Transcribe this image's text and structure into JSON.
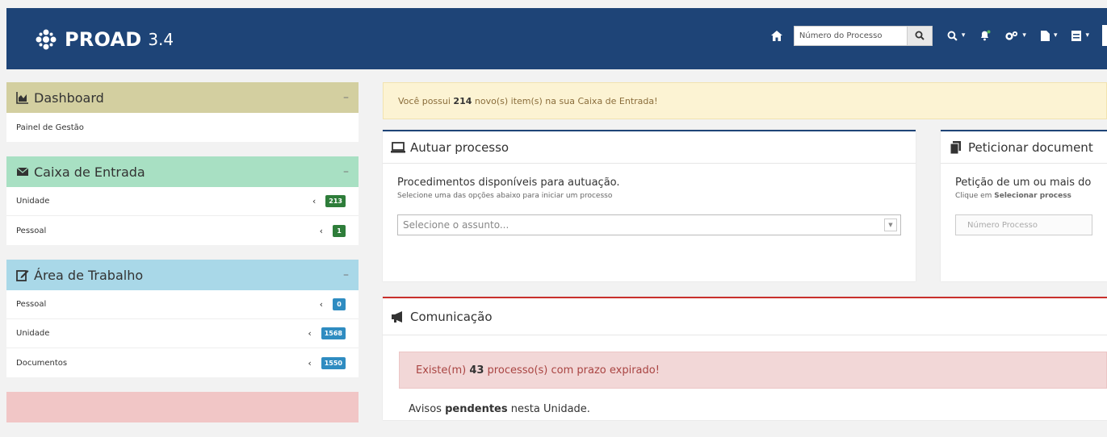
{
  "brand": {
    "name": "PROAD",
    "version": "3.4"
  },
  "navbar": {
    "search_placeholder": "Número do Processo",
    "icons": [
      "home-icon",
      "search-icon",
      "advanced-search-icon",
      "bell-icon",
      "cogs-icon",
      "file-icon",
      "archive-icon"
    ]
  },
  "sidebar": {
    "dashboard": {
      "title": "Dashboard",
      "collapse": "–",
      "items": [
        {
          "label": "Painel de Gestão"
        }
      ]
    },
    "inbox": {
      "title": "Caixa de Entrada",
      "collapse": "–",
      "items": [
        {
          "label": "Unidade",
          "badge": "213"
        },
        {
          "label": "Pessoal",
          "badge": "1"
        }
      ]
    },
    "workarea": {
      "title": "Área de Trabalho",
      "collapse": "–",
      "items": [
        {
          "label": "Pessoal",
          "badge": "0"
        },
        {
          "label": "Unidade",
          "badge": "1568"
        },
        {
          "label": "Documentos",
          "badge": "1550"
        }
      ]
    },
    "colors": {
      "dashboard": "#d3cfa0",
      "inbox": "#a8e0c3",
      "workarea": "#a9d8e8",
      "next": "#f1c6c6"
    }
  },
  "inbox_alert": {
    "prefix": "Você possui ",
    "count": "214",
    "suffix": " novo(s) item(s) na sua Caixa de Entrada!"
  },
  "autuar": {
    "title": "Autuar processo",
    "lead": "Procedimentos disponíveis para autuação.",
    "sub": "Selecione uma das opções abaixo para iniciar um processo",
    "select_placeholder": "Selecione o assunto..."
  },
  "peticionar": {
    "title": "Peticionar document",
    "lead": "Petição de um ou mais do",
    "sub_prefix": "Clique em ",
    "sub_bold": "Selecionar process",
    "input_placeholder": "Número Processo"
  },
  "comunicacao": {
    "title": "Comunicação",
    "alert_prefix": "Existe(m) ",
    "alert_count": "43",
    "alert_suffix": " processo(s) com prazo expirado!",
    "avisos_prefix": "Avisos ",
    "avisos_bold": "pendentes",
    "avisos_suffix": " nesta Unidade."
  },
  "colors": {
    "navbar": "#1e4477",
    "alert_warning_bg": "#fcf3d3",
    "alert_danger_bg": "#f2d7d7",
    "badge_green": "#2e7d3a",
    "badge_blue": "#2f8cc1"
  }
}
